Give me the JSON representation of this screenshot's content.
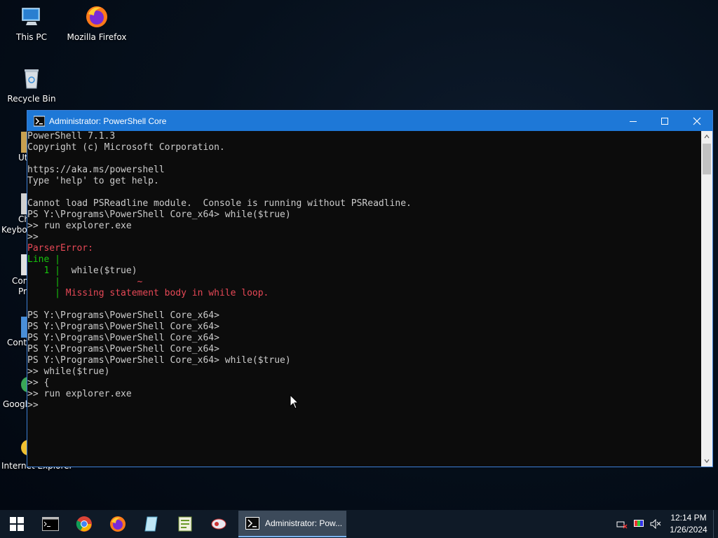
{
  "desktop": {
    "icons": [
      {
        "label": "This PC"
      },
      {
        "label": "Mozilla Firefox"
      },
      {
        "label": "Recycle Bin"
      }
    ],
    "partial_labels": [
      "Ut",
      "Ch",
      "Keyboa",
      "Con",
      "Pr",
      "Contr",
      "Googl",
      "Internet Explorer"
    ]
  },
  "window": {
    "title": "Administrator: PowerShell Core",
    "console_lines": [
      {
        "text": "PowerShell 7.1.3",
        "style": "normal"
      },
      {
        "text": "Copyright (c) Microsoft Corporation.",
        "style": "normal"
      },
      {
        "text": "",
        "style": "normal"
      },
      {
        "text": "https://aka.ms/powershell",
        "style": "normal"
      },
      {
        "text": "Type 'help' to get help.",
        "style": "normal"
      },
      {
        "text": "",
        "style": "normal"
      },
      {
        "text": "Cannot load PSReadline module.  Console is running without PSReadline.",
        "style": "normal"
      },
      {
        "text": "PS Y:\\Programs\\PowerShell Core_x64> while($true)",
        "style": "normal"
      },
      {
        "text": ">> run explorer.exe",
        "style": "normal"
      },
      {
        "text": ">>",
        "style": "normal"
      },
      {
        "text": "ParserError:",
        "style": "err"
      },
      {
        "text": "Line |",
        "style": "grn"
      },
      {
        "text": "   1 |  while($true)",
        "style": "mixed1"
      },
      {
        "text": "     |              ~",
        "style": "mixed2"
      },
      {
        "text": "     | Missing statement body in while loop.",
        "style": "mixed3"
      },
      {
        "text": "",
        "style": "normal"
      },
      {
        "text": "PS Y:\\Programs\\PowerShell Core_x64>",
        "style": "normal"
      },
      {
        "text": "PS Y:\\Programs\\PowerShell Core_x64>",
        "style": "normal"
      },
      {
        "text": "PS Y:\\Programs\\PowerShell Core_x64>",
        "style": "normal"
      },
      {
        "text": "PS Y:\\Programs\\PowerShell Core_x64>",
        "style": "normal"
      },
      {
        "text": "PS Y:\\Programs\\PowerShell Core_x64> while($true)",
        "style": "normal"
      },
      {
        "text": ">> while($true)",
        "style": "normal"
      },
      {
        "text": ">> {",
        "style": "normal"
      },
      {
        "text": ">> run explorer.exe",
        "style": "normal"
      },
      {
        "text": ">>",
        "style": "normal"
      }
    ]
  },
  "taskbar": {
    "active_app_label": "Administrator: Pow...",
    "clock_time": "12:14 PM",
    "clock_date": "1/26/2024"
  },
  "colors": {
    "titlebar": "#1e78d7",
    "console_bg": "#0c0c0c",
    "console_fg": "#cccccc",
    "error": "#e74856",
    "green": "#16c60c"
  }
}
